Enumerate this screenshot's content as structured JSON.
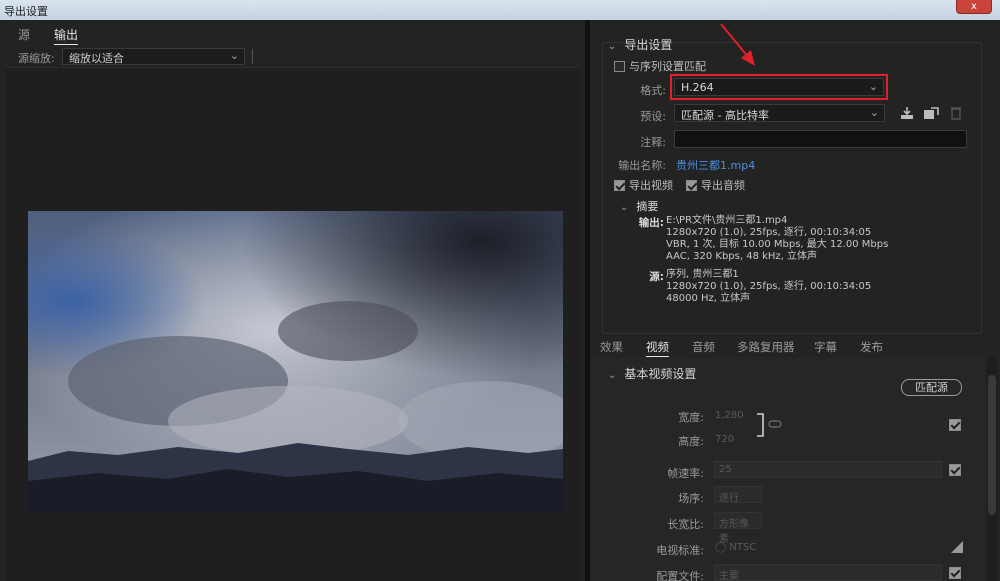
{
  "window": {
    "title": "导出设置",
    "close_label": "x"
  },
  "left": {
    "tabs": [
      {
        "label": "源"
      },
      {
        "label": "输出"
      }
    ],
    "zoom_label": "源缩放:",
    "zoom_value": "缩放以适合"
  },
  "export": {
    "section_title": "导出设置",
    "match_sequence_label": "与序列设置匹配",
    "format_label": "格式:",
    "format_value": "H.264",
    "preset_label": "预设:",
    "preset_value": "匹配源 - 高比特率",
    "comment_label": "注释:",
    "comment_value": "",
    "output_name_label": "输出名称:",
    "output_name_value": "贵州三都1.mp4",
    "export_video_label": "导出视频",
    "export_audio_label": "导出音频",
    "summary_title": "摘要",
    "output_key": "输出:",
    "output_lines": [
      "E:\\PR文件\\贵州三都1.mp4",
      "1280x720 (1.0), 25fps, 逐行, 00:10:34:05",
      "VBR, 1 次, 目标 10.00 Mbps, 最大 12.00 Mbps",
      "AAC, 320 Kbps, 48 kHz, 立体声"
    ],
    "source_key": "源:",
    "source_lines": [
      "序列, 贵州三都1",
      "1280x720 (1.0), 25fps, 逐行, 00:10:34:05",
      "48000 Hz, 立体声"
    ]
  },
  "tabs": [
    {
      "label": "效果"
    },
    {
      "label": "视频"
    },
    {
      "label": "音频"
    },
    {
      "label": "多路复用器"
    },
    {
      "label": "字幕"
    },
    {
      "label": "发布"
    }
  ],
  "video": {
    "section_title": "基本视频设置",
    "match_source_label": "匹配源",
    "width_label": "宽度:",
    "width_value": "1,280",
    "height_label": "高度:",
    "height_value": "720",
    "framerate_label": "帧速率:",
    "framerate_value": "25",
    "field_order_label": "场序:",
    "field_order_value": "逐行",
    "aspect_label": "长宽比:",
    "aspect_value": "方形像素",
    "tv_standard_label": "电视标准:",
    "tv_standard_value": "NTSC",
    "profile_label": "配置文件:",
    "profile_value": "主要"
  },
  "colors": {
    "accent_highlight": "#e0202a",
    "link": "#4a8fe0"
  }
}
